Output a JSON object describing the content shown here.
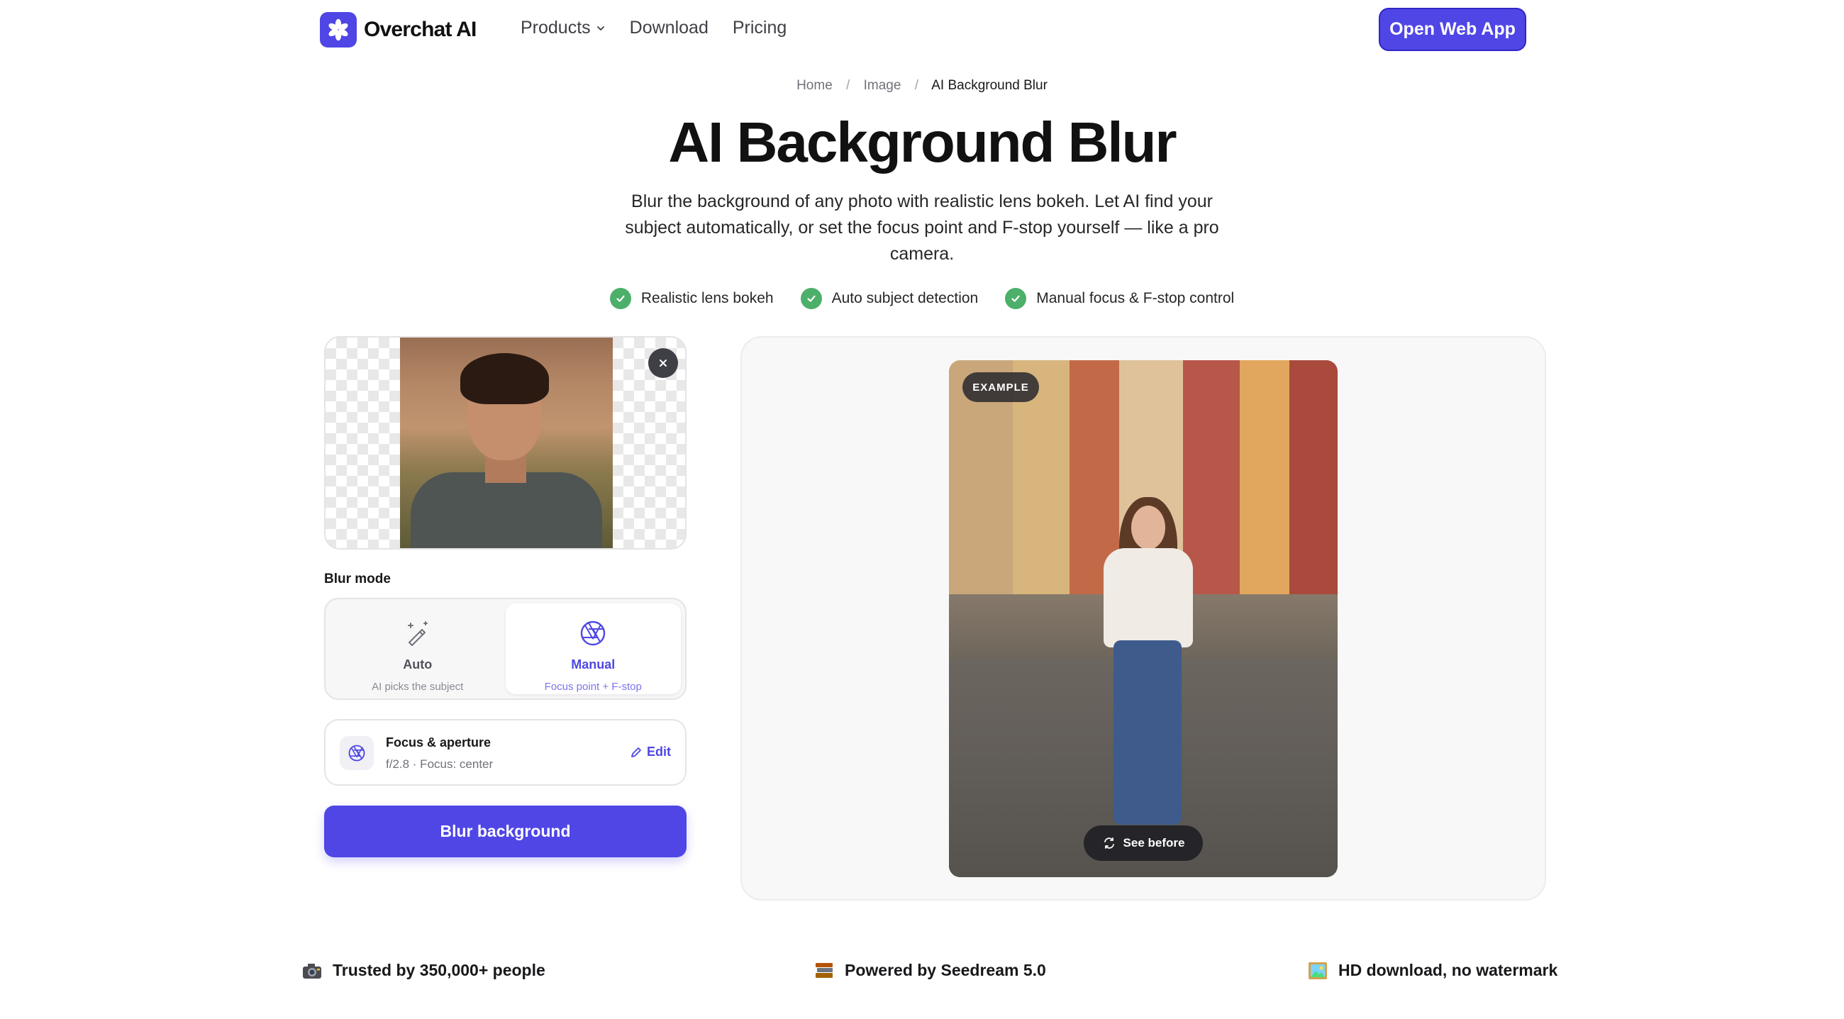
{
  "brand": {
    "name": "Overchat AI",
    "accent": "#4f46e5"
  },
  "nav": {
    "items": [
      {
        "label": "Products",
        "has_dropdown": true
      },
      {
        "label": "Download"
      },
      {
        "label": "Pricing"
      }
    ],
    "cta_label": "Open Web App"
  },
  "breadcrumb": {
    "items": [
      "Home",
      "Image",
      "AI Background Blur"
    ],
    "separator": "/"
  },
  "hero": {
    "title": "AI Background Blur",
    "subtitle": "Blur the background of any photo with realistic lens bokeh. Let AI find your subject automatically, or set the focus point and F-stop yourself — like a pro camera.",
    "features": [
      "Realistic lens bokeh",
      "Auto subject detection",
      "Manual focus & F-stop control"
    ],
    "feature_icon": "check-circle-icon",
    "feature_color": "#4caf6a"
  },
  "tool": {
    "blur_mode_label": "Blur mode",
    "modes": [
      {
        "name": "Auto",
        "description": "AI picks the subject",
        "icon": "magic-wand-icon",
        "selected": false
      },
      {
        "name": "Manual",
        "description": "Focus point + F-stop",
        "icon": "aperture-icon",
        "selected": true
      }
    ],
    "focus": {
      "title": "Focus & aperture",
      "value": "f/2.8 · Focus: center",
      "edit_label": "Edit"
    },
    "action_label": "Blur background"
  },
  "preview": {
    "badge": "EXAMPLE",
    "toggle_label": "See before"
  },
  "trust": [
    {
      "icon": "camera-emoji",
      "label": "Trusted by 350,000+ people"
    },
    {
      "icon": "books-emoji",
      "label": "Powered by Seedream 5.0"
    },
    {
      "icon": "framed-picture-emoji",
      "label": "HD download, no watermark"
    }
  ]
}
